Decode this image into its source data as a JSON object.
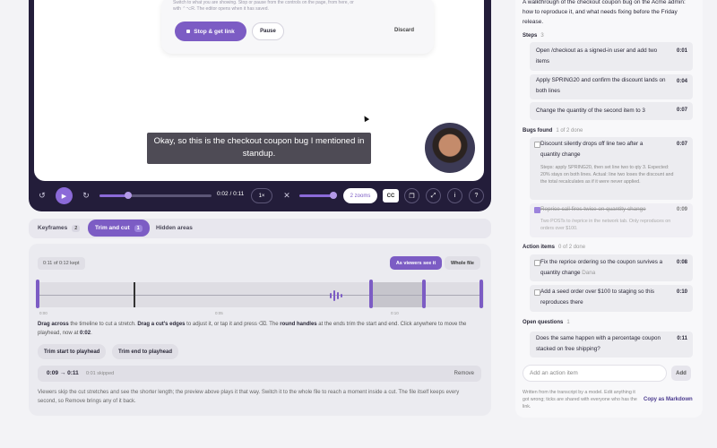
{
  "recorder": {
    "hint": "Switch to what you are showing. Stop or pause from the controls on the page, from here, or with ⌃⌥R. The editor opens when it has saved.",
    "stop_label": "Stop & get link",
    "pause_label": "Pause",
    "discard_label": "Discard"
  },
  "caption": "Okay, so this is the checkout coupon bug I mentioned in standup.",
  "player": {
    "time": "0:02 / 0:11",
    "speed": "1×",
    "zooms": "2 zooms",
    "cc": "CC",
    "progress_percent": 25
  },
  "tabs": [
    {
      "label": "Keyframes",
      "count": "2"
    },
    {
      "label": "Trim and cut",
      "count": "1"
    },
    {
      "label": "Hidden areas",
      "count": ""
    }
  ],
  "trim": {
    "kept": "0:11 of 0:12 kept",
    "viewers_label": "As viewers see it",
    "whole_label": "Whole file",
    "ticks": [
      "0:00",
      "0:05",
      "0:10"
    ],
    "instr_1b": "Drag across",
    "instr_1": " the timeline to cut a stretch. ",
    "instr_2b": "Drag a cut's edges",
    "instr_2": " to adjust it, or tap it and press ⌫. The ",
    "instr_3b": "round handles",
    "instr_3": " at the ends trim the start and end. Click anywhere to move the playhead, now at ",
    "instr_4b": "0:02",
    "instr_end": ".",
    "trim_start": "Trim start to playhead",
    "trim_end": "Trim end to playhead",
    "range": "0:09 → 0:11",
    "skipped": "0:01 skipped",
    "remove": "Remove",
    "footnote": "Viewers skip the cut stretches and see the shorter length; the preview above plays it that way. Switch it to the whole file to reach a moment inside a cut. The file itself keeps every second, so Remove brings any of it back."
  },
  "summary": {
    "intro": "A walkthrough of the checkout coupon bug on the Acme admin: how to reproduce it, and what needs fixing before the Friday release.",
    "steps_title": "Steps",
    "steps_count": "3",
    "steps": [
      {
        "text": "Open /checkout as a signed-in user and add two items",
        "time": "0:01"
      },
      {
        "text": "Apply SPRING20 and confirm the discount lands on both lines",
        "time": "0:04"
      },
      {
        "text": "Change the quantity of the second item to 3",
        "time": "0:07"
      }
    ],
    "bugs_title": "Bugs found",
    "bugs_count": "1 of 2 done",
    "bugs": [
      {
        "text": "Discount silently drops off line two after a quantity change",
        "time": "0:07",
        "detail": "Steps: apply SPRING20, then set line two to qty 3. Expected: 20% stays on both lines. Actual: line two loses the discount and the total recalculates as if it were never applied.",
        "done": false
      },
      {
        "text": "Reprice call fires twice on quantity change",
        "time": "0:09",
        "detail": "Two POSTs to /reprice in the network tab. Only reproduces on orders over $100.",
        "done": true
      }
    ],
    "actions_title": "Action items",
    "actions_count": "0 of 2 done",
    "actions": [
      {
        "text": "Fix the reprice ordering so the coupon survives a quantity change",
        "owner": "Dana",
        "time": "0:08"
      },
      {
        "text": "Add a seed order over $100 to staging so this reproduces there",
        "time": "0:10"
      }
    ],
    "questions_title": "Open questions",
    "questions_count": "1",
    "questions": [
      {
        "text": "Does the same happen with a percentage coupon stacked on free shipping?",
        "time": "0:11"
      }
    ],
    "add_placeholder": "Add an action item",
    "add_label": "Add",
    "footnote": "Written from the transcript by a model. Edit anything it got wrong; ticks are shared with everyone who has the link.",
    "copy_label": "Copy as Markdown"
  },
  "colors": {
    "accent": "#7c5cc4",
    "frame": "#231d3a"
  }
}
